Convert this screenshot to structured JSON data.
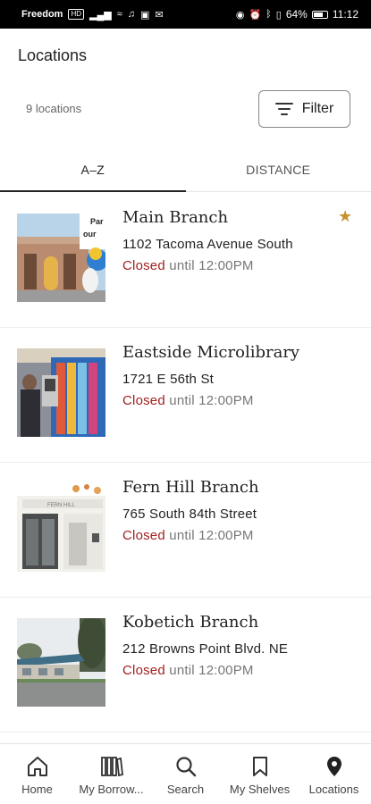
{
  "status_bar": {
    "carrier": "Freedom",
    "hd": "HD",
    "battery": "64%",
    "time": "11:12"
  },
  "header": {
    "title": "Locations",
    "count": "9 locations",
    "filter_label": "Filter"
  },
  "tabs": [
    {
      "label": "A–Z",
      "active": true
    },
    {
      "label": "DISTANCE",
      "active": false
    }
  ],
  "locations": [
    {
      "name": "Main Branch",
      "address": "1102 Tacoma Avenue South",
      "status": "Closed",
      "until": "until 12:00PM",
      "favorite": true
    },
    {
      "name": "Eastside Microlibrary",
      "address": "1721 E 56th St",
      "status": "Closed",
      "until": "until 12:00PM",
      "favorite": false
    },
    {
      "name": "Fern Hill Branch",
      "address": "765 South 84th Street",
      "status": "Closed",
      "until": "until 12:00PM",
      "favorite": false
    },
    {
      "name": "Kobetich Branch",
      "address": "212 Browns Point Blvd. NE",
      "status": "Closed",
      "until": "until 12:00PM",
      "favorite": false
    }
  ],
  "nav": [
    {
      "label": "Home",
      "icon": "home-icon"
    },
    {
      "label": "My Borrow...",
      "icon": "books-icon"
    },
    {
      "label": "Search",
      "icon": "search-icon"
    },
    {
      "label": "My Shelves",
      "icon": "bookmark-icon"
    },
    {
      "label": "Locations",
      "icon": "location-pin-icon"
    }
  ],
  "colors": {
    "closed": "#a31f1f",
    "favorite_star": "#c5922d"
  }
}
